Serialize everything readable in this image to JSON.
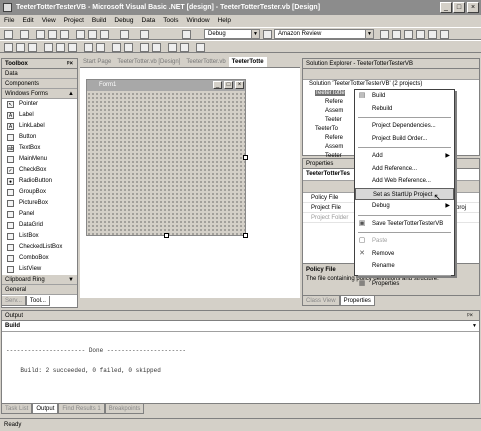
{
  "window": {
    "title": "TeeterTotterTesterVB - Microsoft Visual Basic .NET [design] - TeeterTotterTester.vb [Design]"
  },
  "menu": [
    "File",
    "Edit",
    "View",
    "Project",
    "Build",
    "Debug",
    "Data",
    "Tools",
    "Window",
    "Help"
  ],
  "toolbar": {
    "config": "Debug",
    "find": "Amazon Review"
  },
  "toolbox": {
    "title": "Toolbox",
    "sections": [
      "Data",
      "Components",
      "Windows Forms"
    ],
    "items": [
      "Pointer",
      "Label",
      "LinkLabel",
      "Button",
      "TextBox",
      "MainMenu",
      "CheckBox",
      "RadioButton",
      "GroupBox",
      "PictureBox",
      "Panel",
      "DataGrid",
      "ListBox",
      "CheckedListBox",
      "ComboBox",
      "ListView"
    ],
    "bottom_sections": [
      "Clipboard Ring",
      "General"
    ],
    "tabs": [
      "Serv...",
      "Tool..."
    ]
  },
  "doc_tabs": [
    "Start Page",
    "TeeterTotter.vb [Design]",
    "TeeterTotter.vb",
    "TeeterTotte"
  ],
  "form": {
    "title": "Form1"
  },
  "solution": {
    "title": "Solution Explorer - TeeterTotterTesterVB",
    "tree": [
      "Solution 'TeeterTotterTesterVB' (2 projects)",
      "TeeterTotte",
      "Refere",
      "Assem",
      "Teeter",
      "TeeterTo",
      "Refere",
      "Assem",
      "Teeter"
    ]
  },
  "properties": {
    "title": "Properties",
    "object": "TeeterTotterTes",
    "rows": [
      "Policy File",
      "Project File",
      "Project Folder"
    ],
    "project_file_value": "proj",
    "desc_title": "Policy File",
    "desc_text": "The file containing policy definitions and structure."
  },
  "panel_tabs": [
    "Class View",
    "Properties"
  ],
  "context_menu": [
    "Build",
    "Rebuild",
    "Project Dependencies...",
    "Project Build Order...",
    "Add",
    "Add Reference...",
    "Add Web Reference...",
    "Set as StartUp Project",
    "Debug",
    "Save TeeterTotterTesterVB",
    "Paste",
    "Remove",
    "Rename",
    "Properties"
  ],
  "output": {
    "title": "Output",
    "pane": "Build",
    "line1": "---------------------- Done ----------------------",
    "line2": "    Build: 2 succeeded, 0 failed, 0 skipped"
  },
  "bottom_tabs": [
    "Task List",
    "Output",
    "Find Results 1",
    "Breakpoints"
  ],
  "status": "Ready"
}
